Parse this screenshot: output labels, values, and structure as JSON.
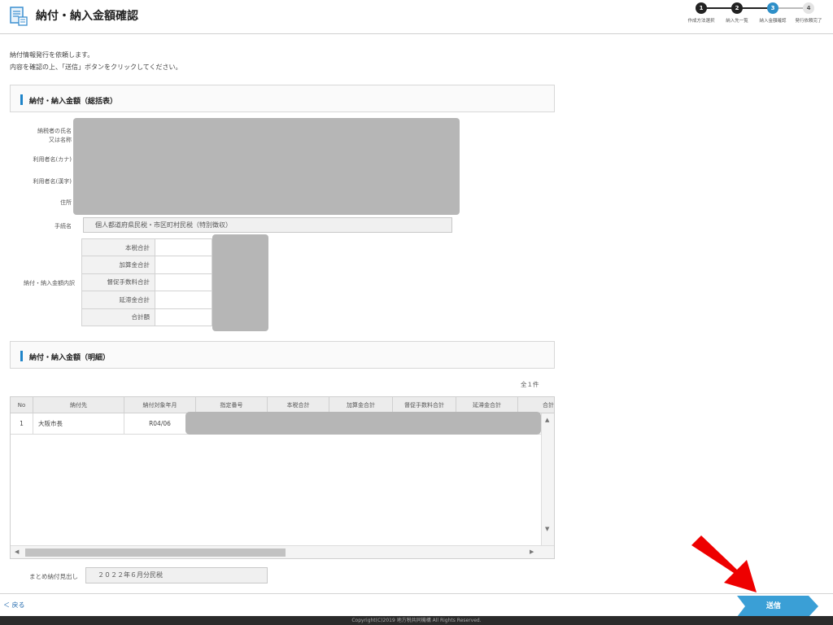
{
  "header": {
    "title": "納付・納入金額確認",
    "steps": [
      {
        "num": "1",
        "label": "作成方法選択",
        "state": "done"
      },
      {
        "num": "2",
        "label": "納入先一覧",
        "state": "done"
      },
      {
        "num": "3",
        "label": "納入金額確認",
        "state": "current"
      },
      {
        "num": "4",
        "label": "発行依頼完了",
        "state": "todo"
      }
    ]
  },
  "intro": {
    "line1": "納付情報発行を依頼します。",
    "line2": "内容を確認の上、「送信」ボタンをクリックしてください。"
  },
  "summary": {
    "title": "納付・納入金額（総括表）",
    "labels": {
      "name_line1": "納税者の氏名",
      "name_line2": "又は名称",
      "kana": "利用者名(カナ)",
      "kanji": "利用者名(漢字)",
      "address": "住所",
      "procedure": "手続名",
      "breakdown": "納付・納入金額内訳"
    },
    "procedure_value": "個人都道府県民税・市区町村民税（特別徴収）",
    "breakdown_rows": [
      "本税合計",
      "加算金合計",
      "督促手数料合計",
      "延滞金合計",
      "合計額"
    ]
  },
  "detail": {
    "title": "納付・納入金額（明細）",
    "count": "全１件",
    "columns": [
      "No",
      "納付先",
      "納付対象年月",
      "指定番号",
      "本税合計",
      "加算金合計",
      "督促手数料合計",
      "延滞金合計",
      "合計"
    ],
    "rows": [
      {
        "no": "1",
        "dest": "大阪市長",
        "period": "R04/06"
      }
    ]
  },
  "batch": {
    "label": "まとめ納付見出し",
    "value": "２０２２年６月分民税"
  },
  "footer": {
    "back": "＜ 戻る",
    "send": "送信",
    "copyright": "Copyright(C)2019 地方税共同機構 All Rights Reserved."
  },
  "colors": {
    "accent": "#2e8fc8",
    "send_button": "#3a9fd6",
    "annotation_arrow": "#ee0000"
  }
}
